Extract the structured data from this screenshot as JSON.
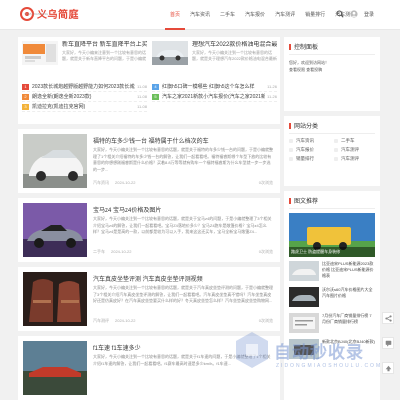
{
  "site": {
    "logo_text": "义乌简庭",
    "logo_sub": "YI WU JIAN TING",
    "login": "登录"
  },
  "nav": [
    "首页",
    "汽车资讯",
    "二手车",
    "汽车报价",
    "汽车测评",
    "销量排行",
    "汽车测评"
  ],
  "top": {
    "feat_a": {
      "title": "新车直降平台 新车直降平台上买过车的朋",
      "desc": "大家好，今天小编来注意到一个比较有意思的话题，就是关于新车直降平台的问题，于是小编就整理了"
    },
    "feat_b": {
      "title": "理想汽车2022款价格油电混合最新",
      "desc": "大家好，今天小编关注到一个比较有意思的话题，就是关于理想汽车2022款价格油电混合最新的问题"
    },
    "list_a": [
      {
        "num": "1",
        "text": "2023款长城炮越野版越野能力如何2023款长城炮越",
        "date": "11-08"
      },
      {
        "num": "2",
        "text": "朗逸全新(朗逸全新2023款)",
        "date": "11-08"
      },
      {
        "num": "3",
        "text": "凯迪拉克(凯迪拉克官网)",
        "date": "11-08"
      }
    ],
    "list_b": [
      {
        "num": "4",
        "text": "红旗h5口碑一模哪些 红旗h5这个车怎么样",
        "date": "11-26"
      },
      {
        "num": "5",
        "text": "汽车之家2021新款小汽车报价(汽车之家2021新款",
        "date": "11-26"
      },
      {
        "num": "6",
        "text": "",
        "date": ""
      }
    ],
    "colors": [
      "#e54a3a",
      "#f08a3a",
      "#f3b23a",
      "#5aa3e8",
      "#6cbf5b",
      "#aaa"
    ]
  },
  "posts": [
    {
      "title": "福特的车多少钱一台 福特属于什么档次的车",
      "desc": "大家好，今天小编关注到一个比较有意思的话题，就是关于福特的车多少钱一台的问题，于是小编就整理了1个相关介绍福特的车多少钱一台的解答，让我们一起看看吧。福特福睿斯哪个车型下放的比较有意思的你想想刚福睿斯是什么价格？买着8.8万等等就有购车一个福特福睿斯为什么车型就一步一步选的一步...",
      "cat": "汽车资讯",
      "date": "2024-10-22",
      "views": "0次浏览"
    },
    {
      "title": "宝马z4 宝马z4价格及图片",
      "desc": "大家好，今天小编关注到一个比较有意思的话题，就是关于宝马z4的问题，于是小编就整理了3个相关介绍宝马z4的解答，让我们一起看看吧。宝马Z4落地价多少？宝马Z4跑车是敞篷价格？宝马z4怎么样？宝马z4是是高的一款，以前都是较为可以入手，我来这这还买车，宝马全新宝马敞篷Z4...",
      "cat": "二手车",
      "date": "2024-10-22",
      "views": "0次浏览"
    },
    {
      "title": "汽车真皮坐垫评测 汽车真皮坐垫评测视频",
      "desc": "大家好，今天小编关注到一个比较有意思的话题，就是关于汽车真皮坐垫评测的问题，于是小编就整理了3个相关介绍汽车真皮坐垫评测的解答，让我们一起看看吧。汽车真皮坐垫真不错吗？汽车坐垫真皮好还是仿真皮好？在汽车真皮坐垫要买什么样的好？冬天真皮坐垫怎么样？汽车坐垫真皮坐垫购物网...",
      "cat": "汽车测评",
      "date": "2024-10-22",
      "views": "0次浏览"
    },
    {
      "title": "f1车速 f1车速多少",
      "desc": "大家好，今天小编关注到一个比较有意思的话题，就是关于f1车速的问题，于是小编就整理了1个相关介绍f1车速的解答，让我们一起看看吧。f1赛车最高时速是多少km/h。f1车速...",
      "cat": "汽车资讯",
      "date": "",
      "views": ""
    }
  ],
  "sidebar": {
    "control": {
      "title": "控制面板",
      "line1": "您好，欢迎到访网站！",
      "line2": "查看权限 查看投稿"
    },
    "cats": {
      "title": "网站分类",
      "items": [
        "汽车资讯",
        "二手车",
        "汽车报价",
        "汽车测评",
        "销量排行",
        "汽车测评"
      ]
    },
    "hot": {
      "title": "图文推荐",
      "first": "路虎卫士 防盗提醒车身装修",
      "items": [
        {
          "text": "比亚迪宋PLUS新能源2023款价格 比亚迪宋PLUS新能源价格表"
        },
        {
          "text": "沃尔沃s60汽车价格图片大全 汽车图片价格"
        },
        {
          "text": "7月份汽车厂商销量排行榜 7月份厂商销量排行榜"
        },
        {
          "text": "新款北京BJ40(北京BJ40新款)"
        }
      ]
    }
  },
  "watermark": {
    "text": "自动秒收录",
    "sub": "ZIDONGMIAOSHOULU.COM"
  }
}
